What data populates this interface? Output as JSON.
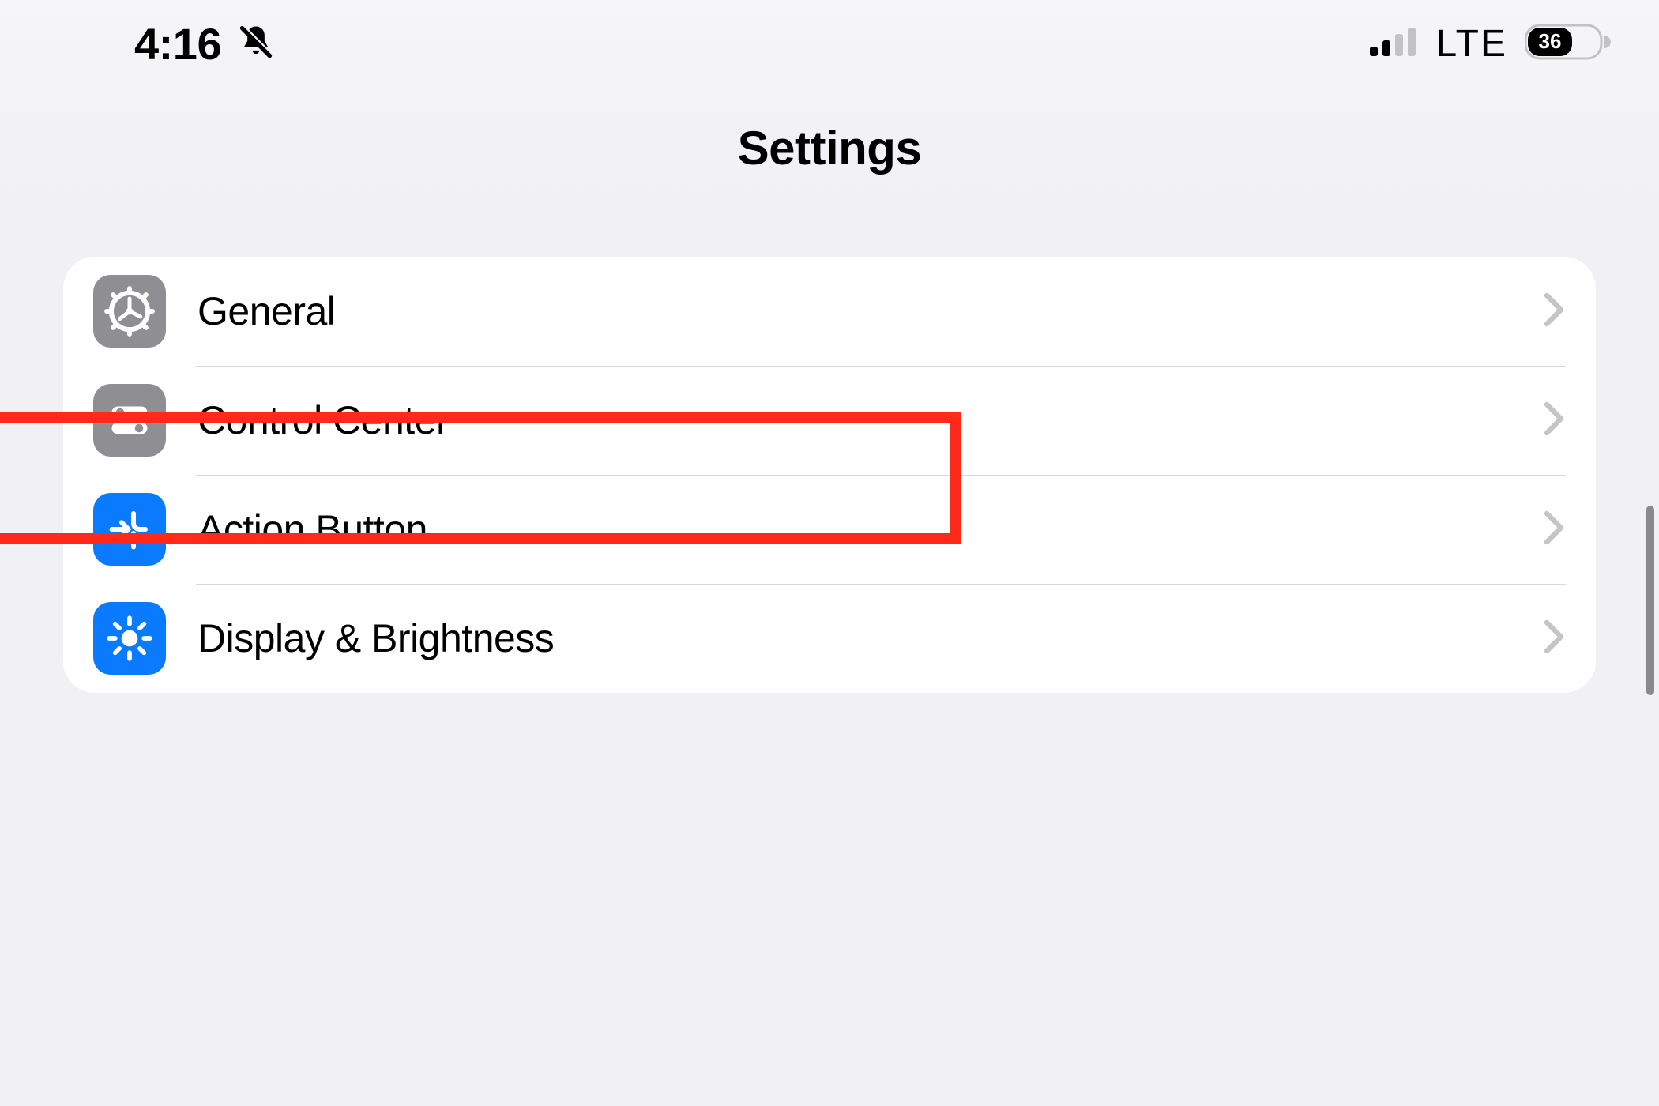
{
  "status": {
    "time": "4:16",
    "silent": true,
    "signal_bars": 2,
    "network": "LTE",
    "battery": "36"
  },
  "header": {
    "title": "Settings"
  },
  "rows": [
    {
      "id": "general",
      "label": "General",
      "icon": "gear-icon",
      "tint": "gray"
    },
    {
      "id": "control",
      "label": "Control Center",
      "icon": "switches-icon",
      "tint": "gray"
    },
    {
      "id": "action",
      "label": "Action Button",
      "icon": "action-arrow-icon",
      "tint": "blue",
      "highlighted": true
    },
    {
      "id": "display",
      "label": "Display & Brightness",
      "icon": "sun-icon",
      "tint": "blue"
    }
  ],
  "colors": {
    "highlight": "#ff2a1a",
    "blue": "#0a7aff",
    "gray": "#8f8f93",
    "chevron": "#c5c5c9",
    "separator": "#d8d8dc",
    "background": "#f1f1f5"
  }
}
